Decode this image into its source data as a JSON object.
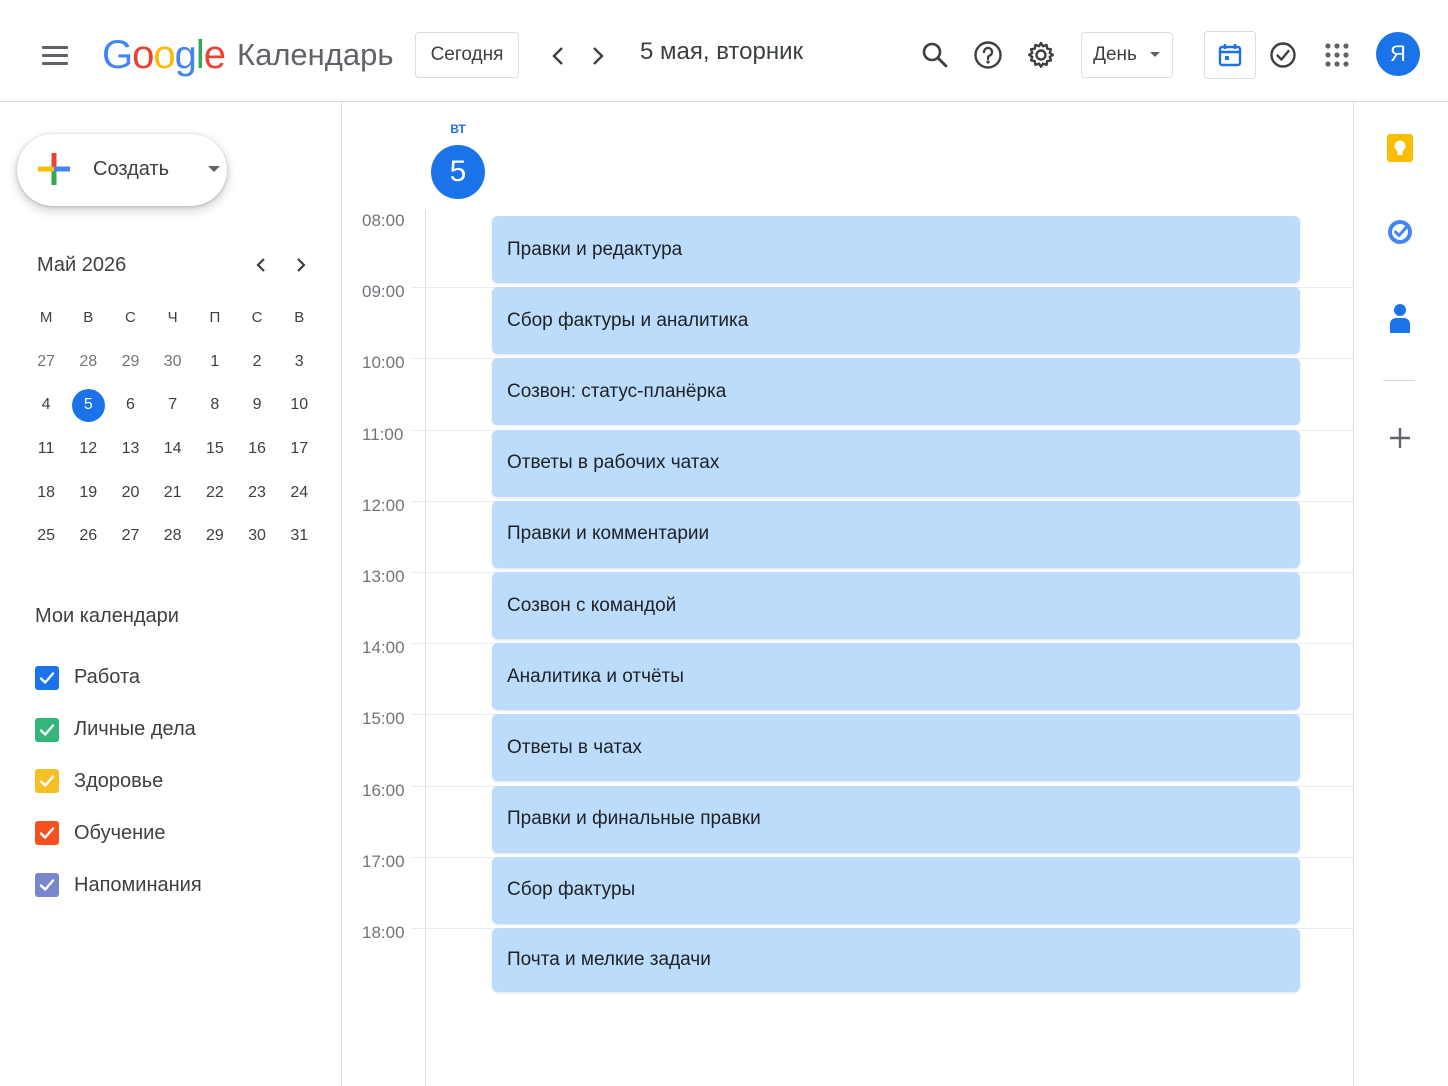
{
  "header": {
    "logo_letters": [
      {
        "ch": "G",
        "color": "#4285F4"
      },
      {
        "ch": "o",
        "color": "#EA4335"
      },
      {
        "ch": "o",
        "color": "#FBBC05"
      },
      {
        "ch": "g",
        "color": "#4285F4"
      },
      {
        "ch": "l",
        "color": "#34A853"
      },
      {
        "ch": "e",
        "color": "#EA4335"
      }
    ],
    "app_name": "Календарь",
    "today_label": "Сегодня",
    "date_title": "5 мая, вторник",
    "view_label": "День",
    "avatar_letter": "Я",
    "icons": [
      "menu-icon",
      "chevron-left-icon",
      "chevron-right-icon",
      "search-icon",
      "help-icon",
      "gear-icon",
      "calendar-icon",
      "tasks-check-icon",
      "apps-grid-icon"
    ]
  },
  "sidebar": {
    "create_label": "Создать",
    "mini_month_title": "Май 2026",
    "weekdays": [
      "М",
      "В",
      "С",
      "Ч",
      "П",
      "С",
      "В"
    ],
    "days": [
      {
        "d": "27",
        "muted": true
      },
      {
        "d": "28",
        "muted": true
      },
      {
        "d": "29",
        "muted": true
      },
      {
        "d": "30",
        "muted": true
      },
      {
        "d": "1"
      },
      {
        "d": "2"
      },
      {
        "d": "3"
      },
      {
        "d": "4"
      },
      {
        "d": "5",
        "today": true
      },
      {
        "d": "6"
      },
      {
        "d": "7"
      },
      {
        "d": "8"
      },
      {
        "d": "9"
      },
      {
        "d": "10"
      },
      {
        "d": "11"
      },
      {
        "d": "12"
      },
      {
        "d": "13"
      },
      {
        "d": "14"
      },
      {
        "d": "15"
      },
      {
        "d": "16"
      },
      {
        "d": "17"
      },
      {
        "d": "18"
      },
      {
        "d": "19"
      },
      {
        "d": "20"
      },
      {
        "d": "21"
      },
      {
        "d": "22"
      },
      {
        "d": "23"
      },
      {
        "d": "24"
      },
      {
        "d": "25"
      },
      {
        "d": "26"
      },
      {
        "d": "27"
      },
      {
        "d": "28"
      },
      {
        "d": "29"
      },
      {
        "d": "30"
      },
      {
        "d": "31"
      }
    ],
    "my_calendars_title": "Мои календари",
    "calendars": [
      {
        "name": "Работа",
        "color": "#1a73e8",
        "checked": true
      },
      {
        "name": "Личные дела",
        "color": "#33b679",
        "checked": true
      },
      {
        "name": "Здоровье",
        "color": "#f6bf26",
        "checked": true
      },
      {
        "name": "Обучение",
        "color": "#f4511e",
        "checked": true
      },
      {
        "name": "Напоминания",
        "color": "#7986cb",
        "checked": true
      }
    ]
  },
  "day_view": {
    "dow": "ВТ",
    "day_number": "5",
    "hours": [
      "08:00",
      "09:00",
      "10:00",
      "11:00",
      "12:00",
      "13:00",
      "14:00",
      "15:00",
      "16:00",
      "17:00",
      "18:00"
    ],
    "event_color": "#bcdcfc",
    "events": [
      {
        "title": "Правки и редактура"
      },
      {
        "title": "Сбор фактуры и аналитика"
      },
      {
        "title": "Созвон: статус-планёрка"
      },
      {
        "title": "Ответы в рабочих чатах"
      },
      {
        "title": "Правки и комментарии"
      },
      {
        "title": "Созвон с командой"
      },
      {
        "title": "Аналитика и отчёты"
      },
      {
        "title": "Ответы в чатах"
      },
      {
        "title": "Правки и финальные правки"
      },
      {
        "title": "Сбор фактуры"
      },
      {
        "title": "Почта и мелкие задачи"
      }
    ]
  },
  "side_rail": {
    "icons": [
      "keep-icon",
      "tasks-icon",
      "contacts-icon",
      "add-icon"
    ]
  }
}
